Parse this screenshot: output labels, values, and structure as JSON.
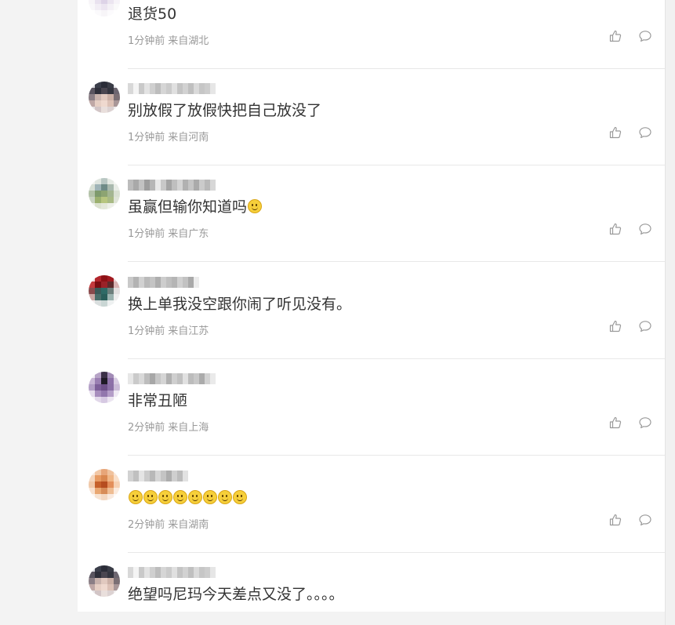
{
  "comments": [
    {
      "text": "退货50",
      "emoji_count": 0,
      "time": "1分钟前",
      "location": "来自湖北",
      "avatar_colors": [
        "#e8e0ee",
        "#d8cde6",
        "#f2eef5",
        "#e4dcea",
        "#f5f2f7",
        "#efe9f3",
        "#cfc3dd",
        "#e2d8ea",
        "#d6cae3",
        "#f3eff6",
        "#f7f5f8",
        "#e9e2ef",
        "#ddd3e7",
        "#ebe5f0",
        "#f6f3f8",
        "#f9f8fa",
        "#f2eef5",
        "#ece6f1",
        "#f4f1f6",
        "#fafafa",
        "#ffffff",
        "#fbfafc",
        "#f7f5f8",
        "#fcfbfd",
        "#ffffff"
      ],
      "name_colors": [
        "#ffffff",
        "#ffffff",
        "#ffffff",
        "#ffffff",
        "#ffffff",
        "#ffffff",
        "#ffffff",
        "#ffffff",
        "#ffffff",
        "#ffffff",
        "#ffffff",
        "#ffffff",
        "#ffffff",
        "#ffffff",
        "#ffffff",
        "#ffffff"
      ]
    },
    {
      "text": "别放假了放假快把自己放没了",
      "emoji_count": 0,
      "time": "1分钟前",
      "location": "来自河南",
      "avatar_colors": [
        "#d9d9de",
        "#3b3e4a",
        "#2b2d38",
        "#3a3c46",
        "#e2e2e6",
        "#5a5560",
        "#2e2f3a",
        "#4a4650",
        "#34353f",
        "#6d6670",
        "#8b7f86",
        "#c9b3ad",
        "#e1c9bf",
        "#cbb0a6",
        "#7b6f74",
        "#bfa8a6",
        "#e6cfc4",
        "#efd9cf",
        "#dcc1b6",
        "#a99798",
        "#e7e4e6",
        "#d2c5c6",
        "#e9dfdc",
        "#dcd2d2",
        "#eeebec"
      ],
      "name_colors": [
        "#d8d8d8",
        "#f4f4f4",
        "#c9c9c9",
        "#e3e3e3",
        "#cfcfcf",
        "#bdbdbd",
        "#d6d6d6",
        "#cbcbcb",
        "#e0e0e0",
        "#c4c4c4",
        "#d2d2d2",
        "#bfbfbf",
        "#dadada",
        "#c6c6c6",
        "#cdcdcd",
        "#e6e6e6"
      ]
    },
    {
      "text": "虽赢但输你知道吗",
      "emoji_count": 1,
      "time": "1分钟前",
      "location": "来自广东",
      "avatar_colors": [
        "#f1f3ef",
        "#dfe5df",
        "#b9c7c3",
        "#e4e9e3",
        "#f5f6f3",
        "#d7dfd5",
        "#9fb4b7",
        "#6f8b87",
        "#a9b9ae",
        "#e8ece6",
        "#b3c2a8",
        "#7e9a6c",
        "#8da472",
        "#a3b591",
        "#d9e0d2",
        "#c9d3c0",
        "#9bb06e",
        "#b7c57f",
        "#a8ba84",
        "#dfe4d8",
        "#eef0ea",
        "#dbe1cf",
        "#e3e7d9",
        "#edefe8",
        "#f5f6f3"
      ],
      "name_colors": [
        "#bcbcbc",
        "#a9a9a9",
        "#c2c2c2",
        "#9d9d9d",
        "#b6b6b6",
        "#e9e9e9",
        "#c8c8c8",
        "#a4a4a4",
        "#bfbfbf",
        "#d4d4d4",
        "#b1b1b1",
        "#c5c5c5",
        "#aaaaaa",
        "#cbcbcb",
        "#b9b9b9",
        "#d7d7d7"
      ]
    },
    {
      "text": "换上单我没空跟你闹了听见没有。",
      "emoji_count": 0,
      "time": "1分钟前",
      "location": "来自江苏",
      "avatar_colors": [
        "#f0dada",
        "#b2262c",
        "#8e1116",
        "#a11a20",
        "#e9cccc",
        "#c33a3d",
        "#7a0d12",
        "#9a2228",
        "#5e2a2c",
        "#d9b3b3",
        "#8a4a4c",
        "#3a5a58",
        "#2f6a66",
        "#6d7f7c",
        "#e3e0e0",
        "#caa6a3",
        "#486e6a",
        "#2a5e5a",
        "#9bb2af",
        "#efeeee",
        "#f3eeee",
        "#d9dede",
        "#c9d6d4",
        "#eef1f1",
        "#fafafa"
      ],
      "name_colors": [
        "#c9c9c9",
        "#b3b3b3",
        "#d1d1d1",
        "#bababa",
        "#c4c4c4",
        "#aeaeae",
        "#cdcdcd",
        "#bfbfbf",
        "#b5b5b5",
        "#d0d0d0",
        "#c2c2c2",
        "#a9a9a9",
        "#ececec",
        "#ffffff",
        "#ffffff",
        "#ffffff"
      ]
    },
    {
      "text": "非常丑陋",
      "emoji_count": 0,
      "time": "2分钟前",
      "location": "来自上海",
      "avatar_colors": [
        "#f1eef4",
        "#b7a4c7",
        "#3b2f47",
        "#a28bb6",
        "#ede8f1",
        "#c9b8d6",
        "#9a7fb2",
        "#1f1a26",
        "#8d70a8",
        "#d8cce2",
        "#b39fc6",
        "#7d5f99",
        "#6e5089",
        "#8b6fa6",
        "#cbbcd8",
        "#e5dcec",
        "#a78dbd",
        "#9277ad",
        "#b49dc8",
        "#efe9f3",
        "#f8f6f9",
        "#e2d8ea",
        "#d6c9e2",
        "#ece5f1",
        "#fbfafc"
      ],
      "name_colors": [
        "#e7e7e7",
        "#cacaca",
        "#d9d9d9",
        "#bdbdbd",
        "#a7a7a7",
        "#c6c6c6",
        "#d5d5d5",
        "#b0b0b0",
        "#cfcfcf",
        "#c1c1c1",
        "#e1e1e1",
        "#bcbcbc",
        "#c8c8c8",
        "#ababab",
        "#d2d2d2",
        "#eaeaea"
      ]
    },
    {
      "text": "",
      "emoji_count": 8,
      "time": "2分钟前",
      "location": "来自湖南",
      "avatar_colors": [
        "#fbe9dd",
        "#f2c7a5",
        "#e7a578",
        "#f0c29d",
        "#fae5d6",
        "#f5d6bd",
        "#e79a62",
        "#d9874f",
        "#f0b686",
        "#fadfc9",
        "#f0c8a8",
        "#c6602a",
        "#b64d1f",
        "#e38f5b",
        "#f6d1b3",
        "#f8e1cf",
        "#e9a772",
        "#d78c58",
        "#efbd93",
        "#fbebde",
        "#fdf6f0",
        "#f7e3d2",
        "#f3d7c1",
        "#f9eadf",
        "#fefaf7"
      ],
      "name_colors": [
        "#d2d2d2",
        "#c0c0c0",
        "#e4e4e4",
        "#cbcbcb",
        "#b8b8b8",
        "#d6d6d6",
        "#c4c4c4",
        "#adadad",
        "#cfcfcf",
        "#bcbcbc",
        "#e2e2e2",
        "#ffffff",
        "#ffffff",
        "#ffffff",
        "#ffffff",
        "#ffffff"
      ]
    },
    {
      "text": "绝望吗尼玛今天差点又没了。。。。",
      "emoji_count": 0,
      "time": "",
      "location": "",
      "avatar_colors": [
        "#d9d9de",
        "#3b3e4a",
        "#2b2d38",
        "#3a3c46",
        "#e2e2e6",
        "#5a5560",
        "#2e2f3a",
        "#4a4650",
        "#34353f",
        "#6d6670",
        "#8b7f86",
        "#c9b3ad",
        "#e1c9bf",
        "#cbb0a6",
        "#7b6f74",
        "#bfa8a6",
        "#e6cfc4",
        "#efd9cf",
        "#dcc1b6",
        "#a99798",
        "#e7e4e6",
        "#d2c5c6",
        "#e9dfdc",
        "#dcd2d2",
        "#eeebec"
      ],
      "name_colors": [
        "#d8d8d8",
        "#f4f4f4",
        "#c9c9c9",
        "#e3e3e3",
        "#cfcfcf",
        "#bdbdbd",
        "#d6d6d6",
        "#cbcbcb",
        "#e0e0e0",
        "#c4c4c4",
        "#d2d2d2",
        "#bfbfbf",
        "#dadada",
        "#c6c6c6",
        "#cdcdcd",
        "#e6e6e6"
      ]
    }
  ],
  "icons": {
    "like": "thumbs-up-icon",
    "reply": "speech-bubble-icon"
  },
  "colors": {
    "text": "#333333",
    "meta": "#999999",
    "divider": "#e8e8e8",
    "icon": "#9a9a9a"
  }
}
